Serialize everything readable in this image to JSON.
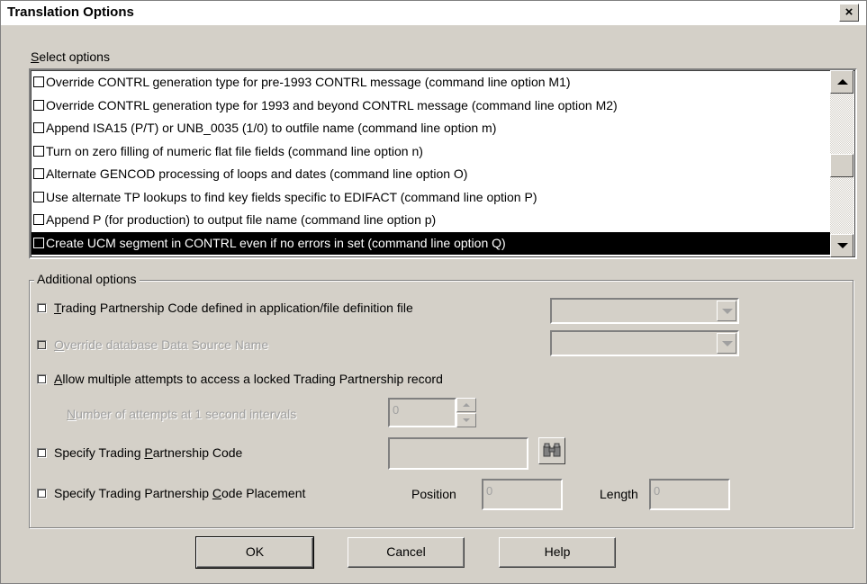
{
  "window": {
    "title": "Translation Options",
    "close_glyph": "×"
  },
  "select_options": {
    "label_underlined": "S",
    "label_rest": "elect options",
    "items": [
      "Override  CONTRL generation type for pre-1993 CONTRL message (command line option M1)",
      "Override CONTRL generation type for 1993 and beyond CONTRL message (command line option M2)",
      "Append ISA15 (P/T) or UNB_0035 (1/0) to outfile name (command line option m)",
      "Turn on zero filling of numeric flat file fields (command line option n)",
      "Alternate GENCOD processing of loops and dates (command line option O)",
      "Use alternate TP lookups to find key fields specific to EDIFACT (command line option P)",
      "Append P (for production) to output file name (command line option p)",
      "Create UCM segment in CONTRL even if no errors in set (command line option Q)"
    ],
    "selected_index": 7
  },
  "additional_options": {
    "legend": "Additional options",
    "tp_code_defined": {
      "underlined": "T",
      "rest": "rading Partnership Code defined in application/file definition file"
    },
    "override_dsn": {
      "underlined": "O",
      "rest": "verride database Data Source Name"
    },
    "allow_multiple": {
      "underlined": "A",
      "rest": "llow multiple attempts to access a locked Trading Partnership record"
    },
    "num_attempts": {
      "underlined": "N",
      "rest": "umber of attempts at 1 second intervals",
      "value": "0"
    },
    "specify_tp_code": {
      "before": "Specify Trading ",
      "underlined": "P",
      "rest": "artnership Code"
    },
    "specify_placement": {
      "before": "Specify Trading Partnership ",
      "underlined": "C",
      "rest": "ode Placement"
    },
    "position_label": "Position",
    "position_value": "0",
    "length_label": "Length",
    "length_value": "0"
  },
  "buttons": {
    "ok": "OK",
    "cancel": "Cancel",
    "help": "Help"
  },
  "icons": {
    "binoculars": "binoculars-icon"
  }
}
